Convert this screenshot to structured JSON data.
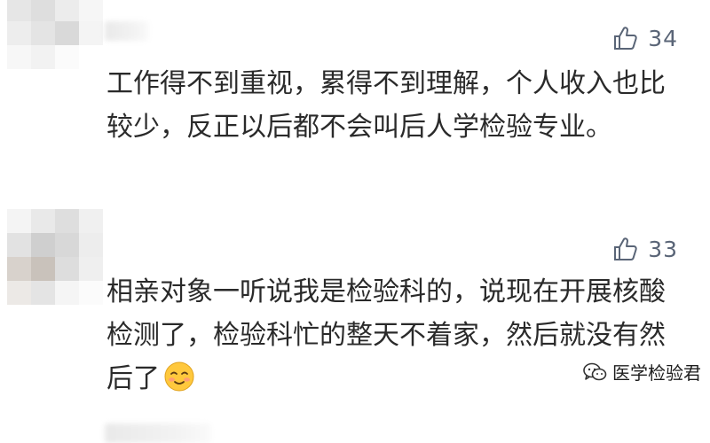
{
  "comments": [
    {
      "likes": "34",
      "text": "工作得不到重视，累得不到理解，个人收入也比较少，反正以后都不会叫后人学检验专业。"
    },
    {
      "likes": "33",
      "text": "相亲对象一听说我是检验科的，说现在开展核酸检测了，检验科忙的整天不着家，然后就没有然后了",
      "emoji": "smiling-face-emoji"
    }
  ],
  "watermark": {
    "icon": "wechat-icon",
    "label": "医学检验君"
  },
  "colors": {
    "background": "#ffffff",
    "text": "#2a2a2a",
    "like": "#5a6577"
  }
}
